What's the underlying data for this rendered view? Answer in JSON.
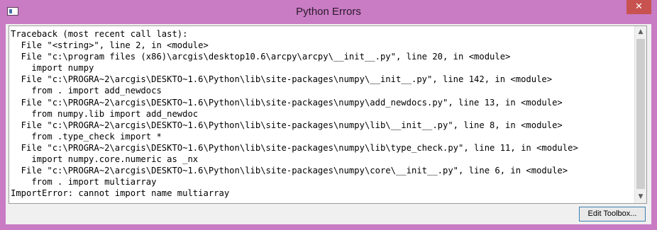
{
  "window": {
    "title": "Python Errors",
    "close_glyph": "✕"
  },
  "traceback": {
    "lines": [
      "Traceback (most recent call last):",
      "  File \"<string>\", line 2, in <module>",
      "  File \"c:\\program files (x86)\\arcgis\\desktop10.6\\arcpy\\arcpy\\__init__.py\", line 20, in <module>",
      "    import numpy",
      "  File \"c:\\PROGRA~2\\arcgis\\DESKTO~1.6\\Python\\lib\\site-packages\\numpy\\__init__.py\", line 142, in <module>",
      "    from . import add_newdocs",
      "  File \"c:\\PROGRA~2\\arcgis\\DESKTO~1.6\\Python\\lib\\site-packages\\numpy\\add_newdocs.py\", line 13, in <module>",
      "    from numpy.lib import add_newdoc",
      "  File \"c:\\PROGRA~2\\arcgis\\DESKTO~1.6\\Python\\lib\\site-packages\\numpy\\lib\\__init__.py\", line 8, in <module>",
      "    from .type_check import *",
      "  File \"c:\\PROGRA~2\\arcgis\\DESKTO~1.6\\Python\\lib\\site-packages\\numpy\\lib\\type_check.py\", line 11, in <module>",
      "    import numpy.core.numeric as _nx",
      "  File \"c:\\PROGRA~2\\arcgis\\DESKTO~1.6\\Python\\lib\\site-packages\\numpy\\core\\__init__.py\", line 6, in <module>",
      "    from . import multiarray",
      "ImportError: cannot import name multiarray"
    ]
  },
  "buttons": {
    "edit_toolbox": "Edit Toolbox..."
  },
  "icons": {
    "app": "app-window-icon",
    "close": "close-icon",
    "scroll_up": "scroll-up-arrow-icon",
    "scroll_down": "scroll-down-arrow-icon"
  },
  "colors": {
    "titlebar": "#c97bc4",
    "close_button": "#c7524f",
    "button_border": "#3c7fb1"
  }
}
